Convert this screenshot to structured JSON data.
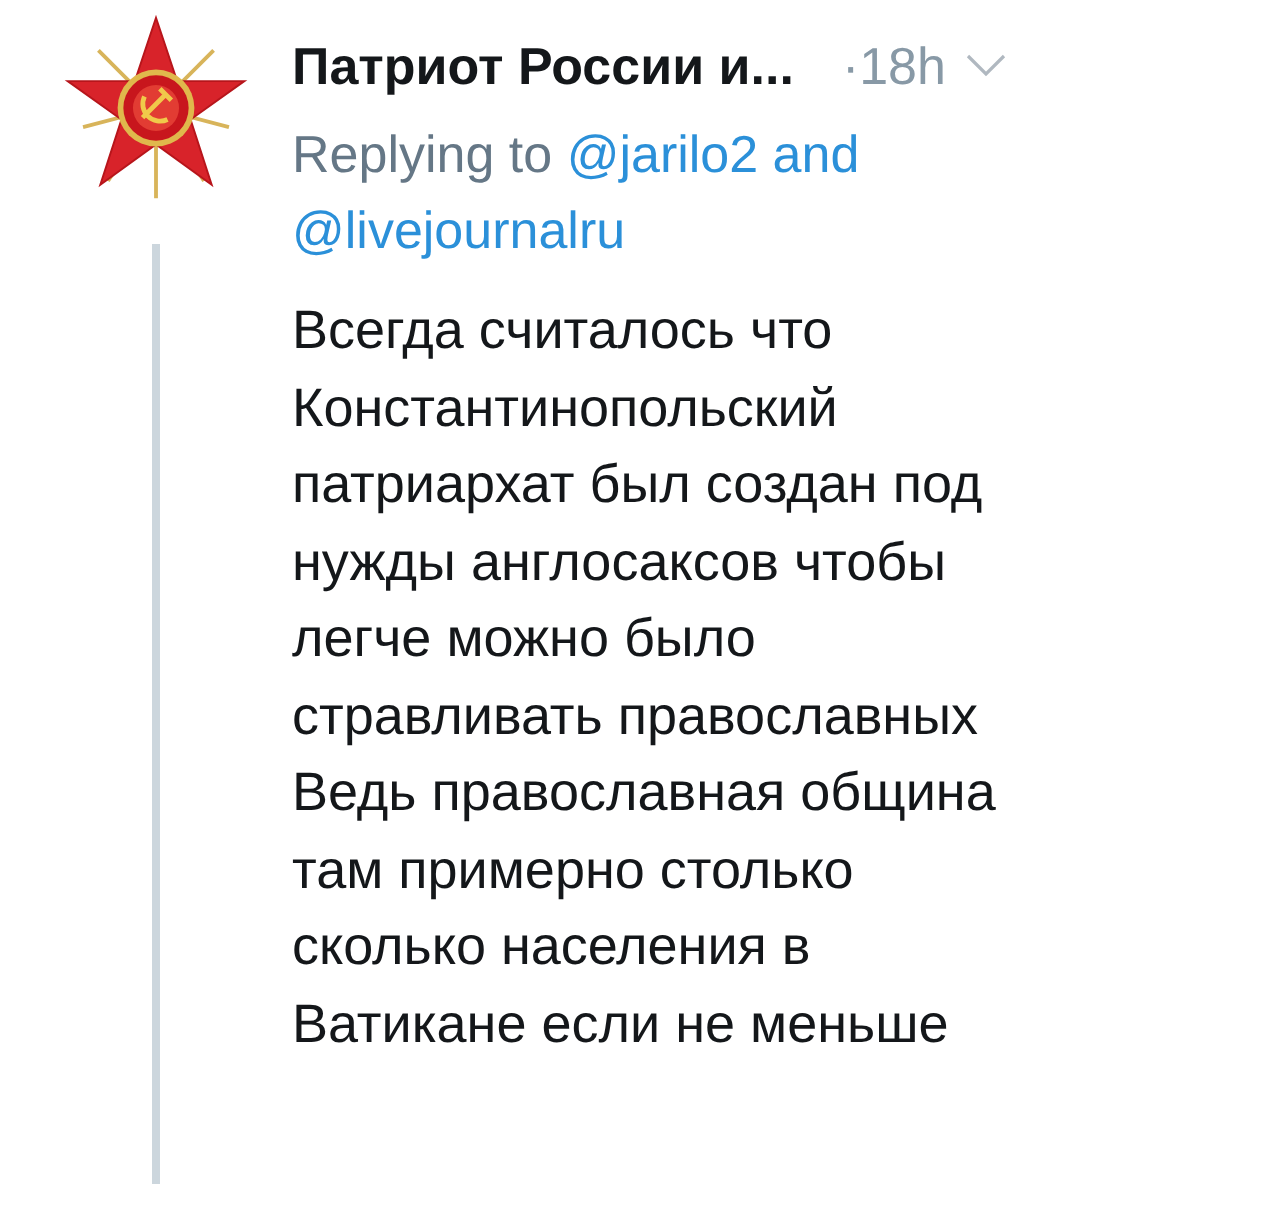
{
  "tweet": {
    "author": "Патриот России и...",
    "time": "·18h",
    "replying_label": "Replying to",
    "reply_to": [
      "@jarilo2",
      "@livejournalru"
    ],
    "reply_joiner": "and",
    "body_lines": [
      "Всегда считалось что",
      "Константинопольский",
      "патриархат был создан под",
      "нужды англосаксов чтобы",
      "легче можно было",
      "стравливать православных",
      "Ведь православная община",
      "там примерно столько",
      "сколько населения в",
      "Ватикане если не меньше"
    ]
  }
}
